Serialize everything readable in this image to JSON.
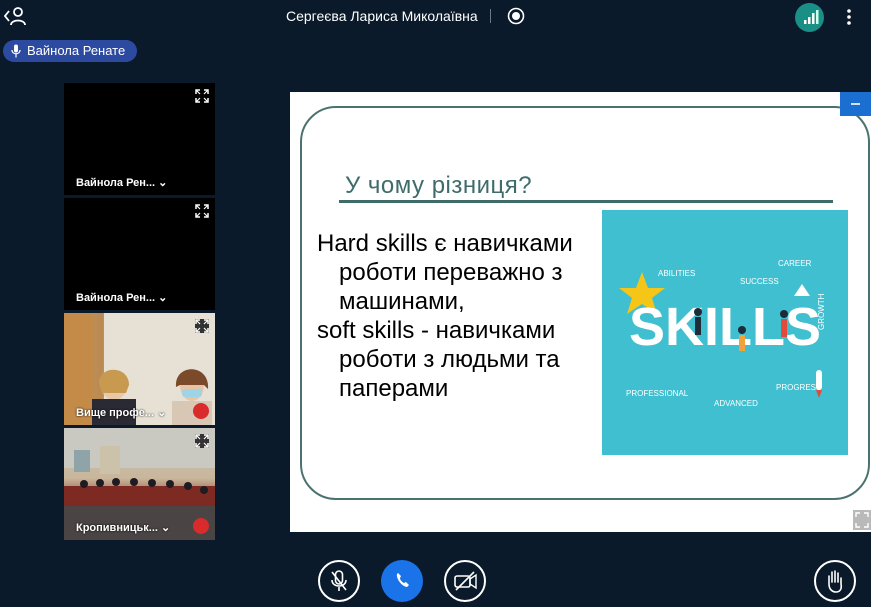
{
  "topbar": {
    "presenter_name": "Сергеєва Лариса Миколаївна"
  },
  "speaker": {
    "name": "Вайнола Ренате"
  },
  "tiles": [
    {
      "name": "Вайнола Рен... ⌄",
      "muted": false
    },
    {
      "name": "Вайнола Рен... ⌄",
      "muted": false
    },
    {
      "name": "Вище профе... ⌄",
      "muted": true
    },
    {
      "name": "Кропивницьк... ⌄",
      "muted": true
    }
  ],
  "slide": {
    "title": "У чому різниця?",
    "body_1": "Hard skills є навичками роботи переважно з машинами,",
    "body_2": "soft skills - навичками роботи з людьми та паперами",
    "image_word": "SKILLS",
    "image_labels": {
      "abilities": "ABILITIES",
      "success": "SUCCESS",
      "career": "CAREER",
      "growth": "GROWTH",
      "professional": "PROFESSIONAL",
      "advanced": "ADVANCED",
      "progress": "PROGRESS"
    }
  },
  "colors": {
    "background": "#0b1a2a",
    "accent": "#1a73e8",
    "signal": "#1a8f86",
    "speaker_pill": "#2b4aa0",
    "slide_teal": "#3d6c6a",
    "image_bg": "#3fbfcf",
    "mute_red": "#d92b2b"
  },
  "controls": {
    "mic": "mic-off-icon",
    "call": "phone-icon",
    "camera": "camera-off-icon",
    "hand": "raise-hand-icon"
  }
}
